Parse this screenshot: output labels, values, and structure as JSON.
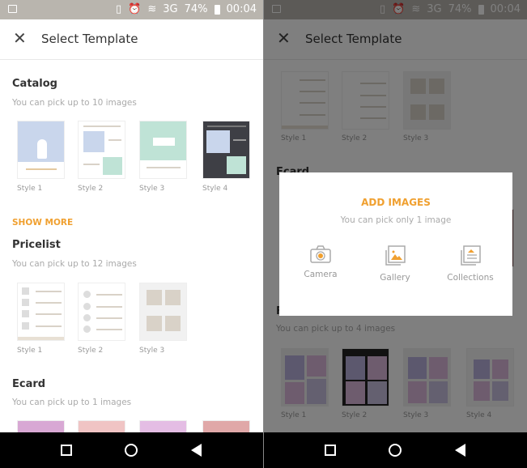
{
  "status_bar": {
    "battery": "74%",
    "time": "00:04",
    "network": "3G"
  },
  "header": {
    "title": "Select Template"
  },
  "sections": {
    "catalog": {
      "title": "Catalog",
      "subtitle": "You can pick up to 10 images",
      "styles": [
        "Style 1",
        "Style 2",
        "Style 3",
        "Style 4"
      ],
      "show_more": "SHOW MORE"
    },
    "pricelist": {
      "title": "Pricelist",
      "subtitle": "You can pick up to 12 images",
      "styles": [
        "Style 1",
        "Style 2",
        "Style 3"
      ]
    },
    "ecard": {
      "title": "Ecard",
      "subtitle": "You can pick up to 1 images"
    },
    "frame": {
      "title": "F",
      "subtitle": "You can pick up to 4 images",
      "styles": [
        "Style 1",
        "Style 2",
        "Style 3",
        "Style 4"
      ]
    }
  },
  "dialog": {
    "title": "ADD IMAGES",
    "subtitle": "You can pick only 1 image",
    "options": [
      "Camera",
      "Gallery",
      "Collections"
    ]
  },
  "colors": {
    "accent": "#f0a030"
  }
}
